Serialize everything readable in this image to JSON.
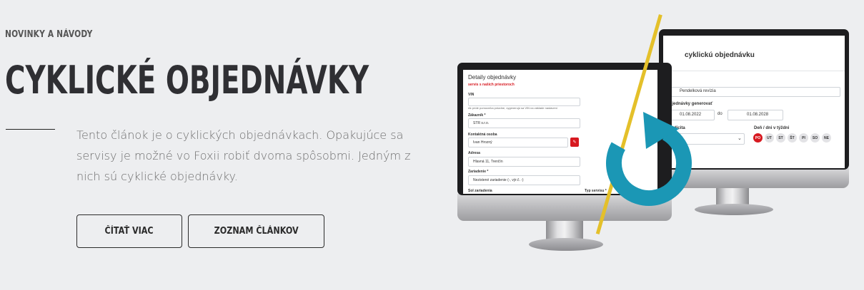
{
  "eyebrow": "NOVINKY A NÁVODY",
  "title": "CYKLICKÉ OBJEDNÁVKY",
  "lead": "Tento článok je o cyklických objednávkach. Opakujúce sa servisy je možné vo Foxii robiť dvoma spôsobmi. Jedným z nich sú cyklické objednávky.",
  "buttons": {
    "read_more": "ČÍTAŤ VIAC",
    "article_list": "ZOZNAM ČLÁNKOV"
  },
  "colors": {
    "background": "#edeef0",
    "accent_yellow": "#e4c02a",
    "cycle_blue": "#1b97b5",
    "red": "#d71920"
  },
  "left_screen": {
    "heading": "Detaily objednávky",
    "checkbox_note": "servis s našich priestoroch",
    "fields": [
      {
        "label": "VIN",
        "value": "",
        "hint": "Ak príde pomocníka prázdne, vygenerujú sa VIN na základe nastavení"
      },
      {
        "label": "Zákazník *",
        "value": "STR s.r.o."
      },
      {
        "label": "Kontaktná osoba",
        "value": "Ivan Hrozný"
      },
      {
        "label": "Adresa",
        "value": "Hlavná 11, Trenčín"
      },
      {
        "label": "Zariadenie *",
        "value": "Nezistené zariadenie (-, výr.č. -)"
      }
    ],
    "footer_left": "Sol zariadenia",
    "footer_right": "Typ servisu *"
  },
  "right_screen": {
    "heading": "cyklickú objednávku",
    "name_label": "zov",
    "name_value": "Pendelková revízia",
    "generate_label": "Objednávky generovať",
    "date_from": "01.08.2022",
    "to_word": "do",
    "date_to": "01.08.2028",
    "periodicity_label": "eriodicita",
    "days_label": "Deň / dni v týždni",
    "days": [
      "PO",
      "UT",
      "ST",
      "ŠT",
      "PI",
      "SO",
      "NE"
    ],
    "selected_day": "PO"
  },
  "icons": {
    "cycle": "refresh-icon",
    "edit": "pencil-icon",
    "dropdown": "chevron-down-icon"
  }
}
